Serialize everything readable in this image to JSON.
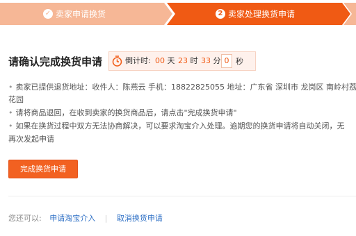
{
  "steps": [
    {
      "label": "卖家申请换货",
      "icon": "✓",
      "state": "done"
    },
    {
      "label": "卖家处理换货申请",
      "icon": "2",
      "state": "active"
    }
  ],
  "colors": {
    "step_done": "#f6b796",
    "step_active": "#f05a14",
    "accent": "#f26121",
    "link": "#2d6fc5"
  },
  "main": {
    "title": "请确认完成换货申请",
    "countdown": {
      "label": "倒计时:",
      "days": "00",
      "days_unit": "天",
      "hours": "23",
      "hours_unit": "时",
      "minutes": "33",
      "minutes_unit": "分",
      "seconds": "0",
      "seconds_unit": "秒"
    },
    "info_lines": [
      "卖家已提供退货地址：收件人：陈燕云  手机：18822825055  地址：广东省 深圳市 龙岗区 南岭村荔枝",
      "花园",
      "请将商品退回，在收到卖家的换货商品后，请点击\"完成换货申请\"",
      "如果在换货过程中双方无法协商解决，可以要求淘宝介入处理。逾期您的换货申请将自动关闭，无",
      "再次发起申请"
    ],
    "complete_button": "完成换货申请"
  },
  "footer": {
    "label": "您还可以:",
    "apply_link": "申请淘宝介入",
    "cancel_link": "取消换货申请"
  }
}
